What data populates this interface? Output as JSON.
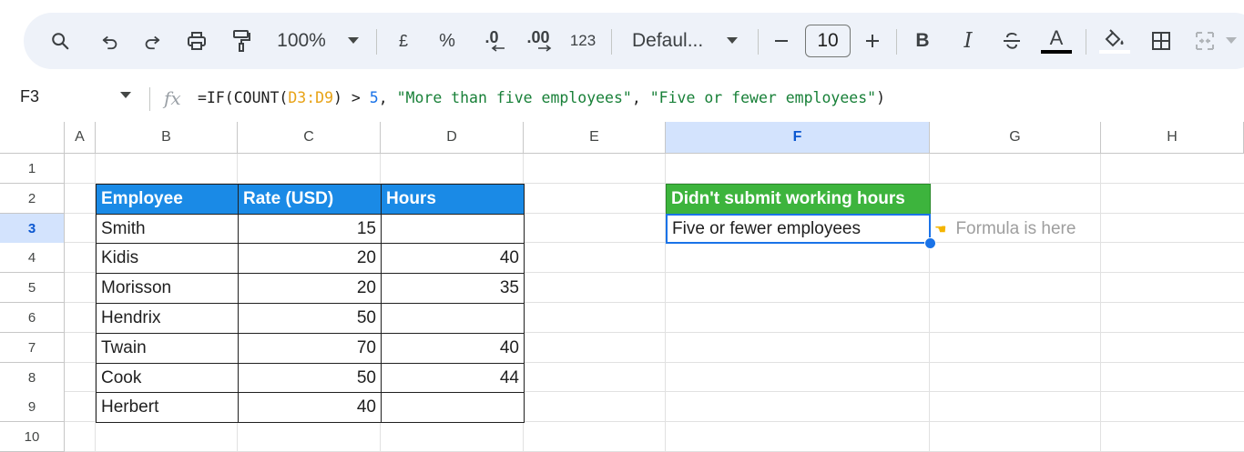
{
  "toolbar": {
    "zoom": "100%",
    "currency": "£",
    "percent": "%",
    "dec_less": ".0",
    "dec_more": ".00",
    "format_num": "123",
    "font": "Defaul...",
    "font_size": "10",
    "bold": "B",
    "italic": "I",
    "text_color_letter": "A"
  },
  "formula_bar": {
    "name_box": "F3",
    "fx": "fx",
    "formula_parts": {
      "prefix": "=IF(COUNT(",
      "range": "D3:D9",
      "mid": ") > ",
      "number": "5",
      "sep": ", ",
      "str_true": "\"More than five employees\"",
      "sep2": ", ",
      "str_false": "\"Five or fewer employees\"",
      "suffix": ")"
    }
  },
  "columns": [
    "A",
    "B",
    "C",
    "D",
    "E",
    "F",
    "G",
    "H"
  ],
  "rows": [
    "1",
    "2",
    "3",
    "4",
    "5",
    "6",
    "7",
    "8",
    "9",
    "10"
  ],
  "selected_cell": {
    "col": "F",
    "row": "3"
  },
  "table": {
    "headers": [
      "Employee",
      "Rate (USD)",
      "Hours"
    ],
    "rows": [
      [
        "Smith",
        "15",
        ""
      ],
      [
        "Kidis",
        "20",
        "40"
      ],
      [
        "Morisson",
        "20",
        "35"
      ],
      [
        "Hendrix",
        "50",
        ""
      ],
      [
        "Twain",
        "70",
        "40"
      ],
      [
        "Cook",
        "50",
        "44"
      ],
      [
        "Herbert",
        "40",
        ""
      ]
    ]
  },
  "result": {
    "header": "Didn't submit working hours",
    "value": "Five or fewer employees",
    "note": "Formula is here"
  },
  "colors": {
    "table_header": "#1a8ae6",
    "result_header": "#3db43d",
    "selection": "#1a73e8",
    "header_selected": "#d3e3fd"
  }
}
